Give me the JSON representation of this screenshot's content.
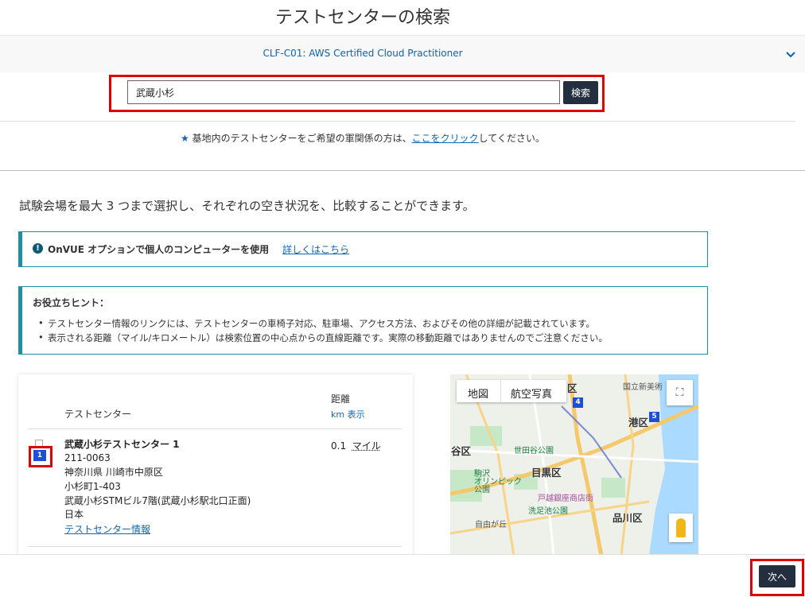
{
  "header": {
    "title": "テストセンターの検索",
    "exam": "CLF-C01: AWS Certified Cloud Practitioner"
  },
  "search": {
    "value": "武蔵小杉",
    "button_label": "検索"
  },
  "military": {
    "text_before": "基地内のテストセンターをご希望の軍関係の方は、",
    "link": "ここをクリック",
    "text_after": "してください。"
  },
  "compare_text": "試験会場を最大 3 つまで選択し、それぞれの空き状況を、比較することができます。",
  "onvue": {
    "text": "OnVUE オプションで個人のコンピューターを使用",
    "link": "詳しくはこちら"
  },
  "tips": {
    "title": "お役立ちヒント：",
    "items": [
      "テストセンター情報のリンクには、テストセンターの車椅子対応、駐車場、アクセス方法、およびその他の詳細が記載されています。",
      "表示される距離（マイル/キロメートル）は検索位置の中心点からの直線距離です。実際の移動距離ではありませんのでご注意ください。"
    ]
  },
  "results": {
    "col_center": "テストセンター",
    "col_distance": "距離",
    "unit_toggle": "km 表示",
    "rows": [
      {
        "marker": "1",
        "name": "武蔵小杉テストセンター 1",
        "postal": "211-0063",
        "address1": "神奈川県 川崎市中原区",
        "address2": "小杉町1-403",
        "address3": "武蔵小杉STMビル7階(武蔵小杉駅北口正面)",
        "country": "日本",
        "info_link": "テストセンター情報",
        "distance_value": "0.1",
        "distance_unit": "マイル"
      }
    ]
  },
  "map": {
    "tab_map": "地図",
    "tab_satellite": "航空写真",
    "labels": {
      "minato": "港区",
      "meguro": "目黒区",
      "shinagawa": "品川区",
      "setagaya": "谷区",
      "ku": "区",
      "setagaya_station": "世田谷公園",
      "komazawa": "駒沢\nオリンピック\n公園",
      "togoshi": "戸越銀座商店街",
      "senzoku": "洗足池公園",
      "jiyugaoka": "自由が丘",
      "kokuritsu": "国立新美術"
    },
    "markers": [
      "4",
      "5"
    ]
  },
  "footer": {
    "next_label": "次へ"
  }
}
